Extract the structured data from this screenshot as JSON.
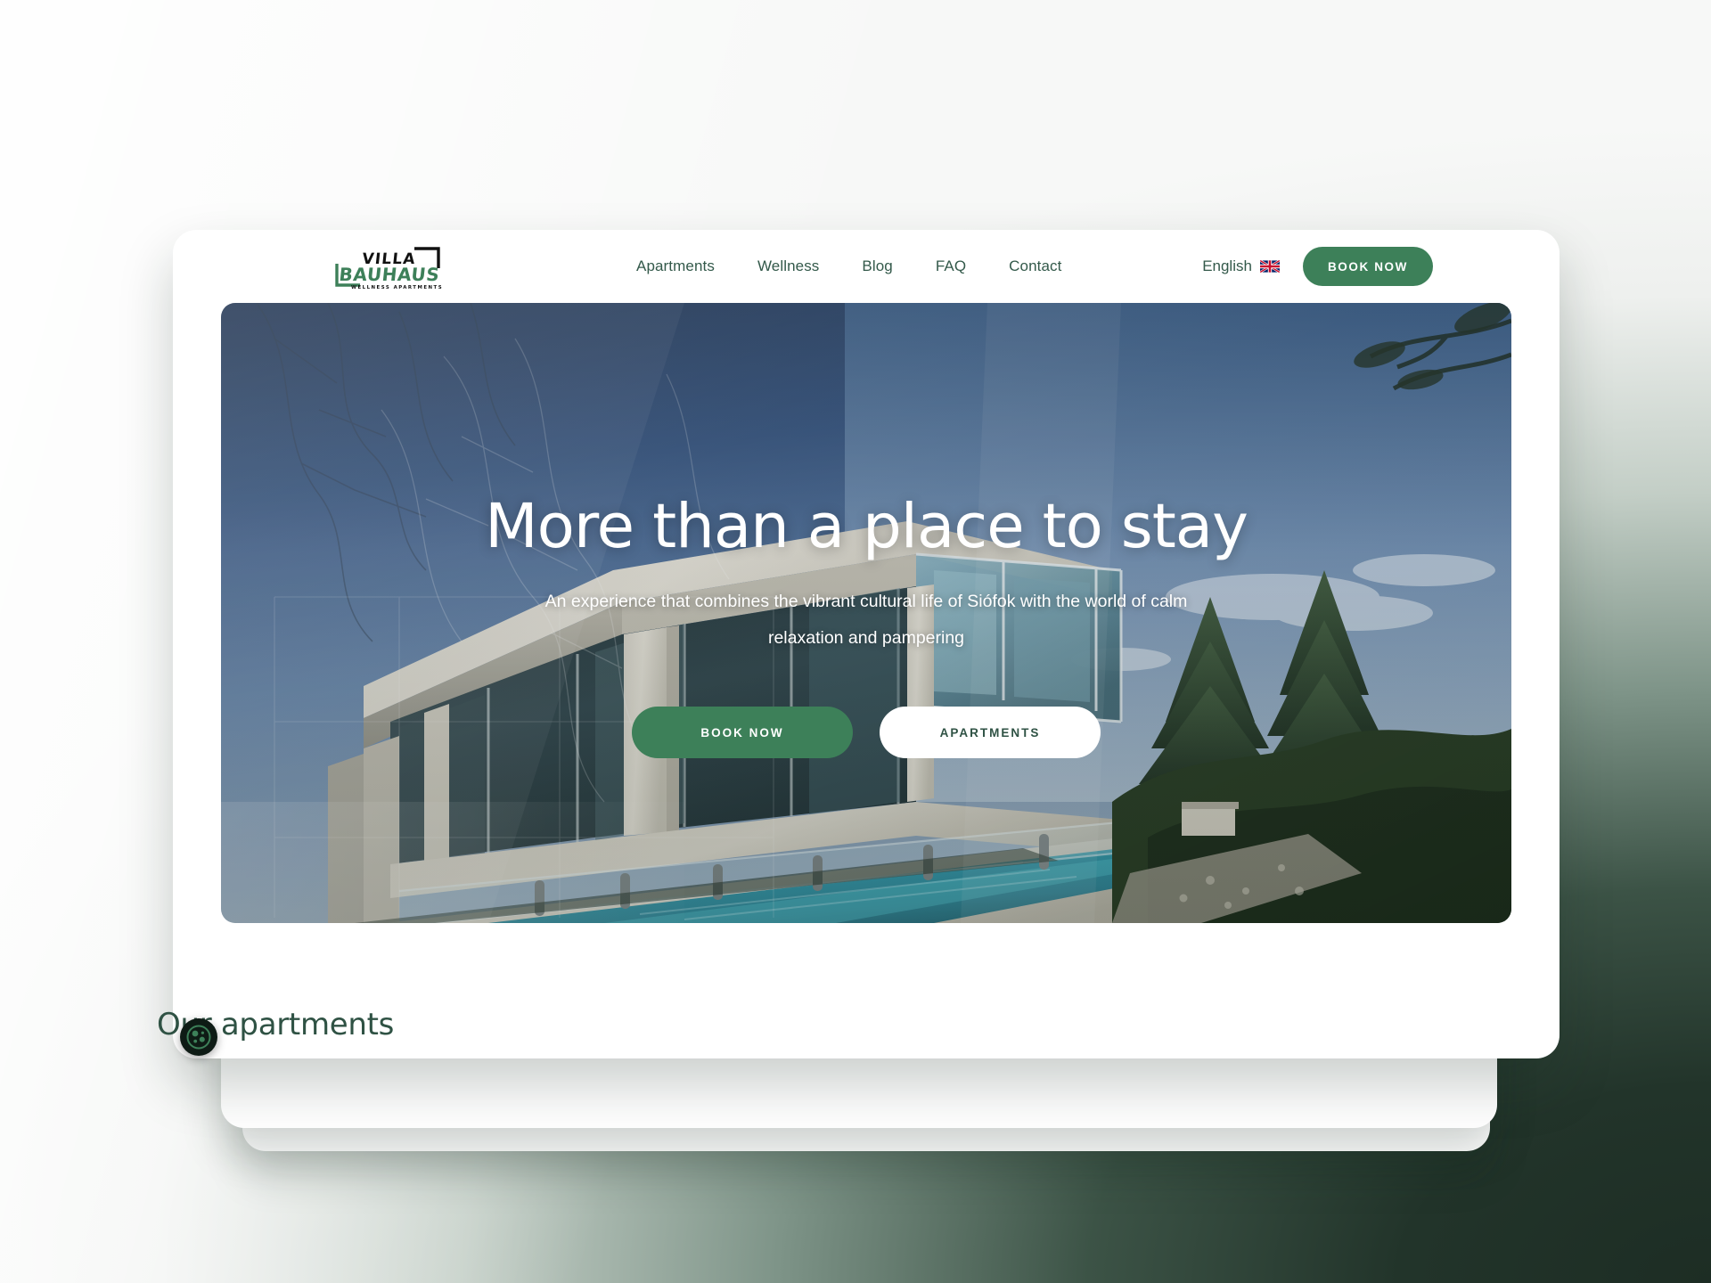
{
  "brand": {
    "logo_line1": "VILLA",
    "logo_line2": "BAUHAUS",
    "logo_tagline": "WELLNESS APARTMENTS"
  },
  "header": {
    "nav": [
      {
        "label": "Apartments"
      },
      {
        "label": "Wellness"
      },
      {
        "label": "Blog"
      },
      {
        "label": "FAQ"
      },
      {
        "label": "Contact"
      }
    ],
    "language": {
      "label": "English",
      "flag": "uk-flag-icon"
    },
    "book_now_label": "BOOK NOW"
  },
  "hero": {
    "title": "More than a place to stay",
    "subtitle": "An experience that combines the vibrant cultural life of Siófok with the world of calm relaxation and pampering",
    "primary_cta": "BOOK NOW",
    "secondary_cta": "APARTMENTS"
  },
  "section": {
    "apartments_title": "Our apartments"
  },
  "widgets": {
    "cookie_icon": "cookie-icon"
  },
  "colors": {
    "brand_green": "#3d8059",
    "dark_green": "#2f5244",
    "nav_green": "#33594a",
    "white": "#ffffff",
    "backdrop_dark": "#1d2d24"
  }
}
